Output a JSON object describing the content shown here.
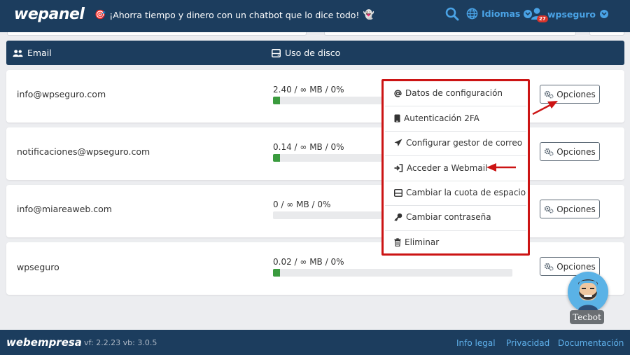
{
  "colors": {
    "navy": "#1c3d5e",
    "accent_blue": "#4aa3e6",
    "progress_green": "#3a9b3e",
    "annotation_red": "#cc1414"
  },
  "topbar": {
    "logo": "wepanel",
    "promo_icon": "target-emoji",
    "promo_text": "¡Ahorra tiempo y dinero con un chatbot que lo dice todo!",
    "promo_icon_end": "ghost-emoji",
    "search_icon": "search-icon",
    "languages_label": "Idiomas",
    "user_label": "wpseguro",
    "notification_count": "27"
  },
  "table": {
    "col_email": "Email",
    "col_disk": "Uso de disco",
    "rows": [
      {
        "email": "info@wpseguro.com",
        "usage": "2.40 / ∞ MB / 0%",
        "fill_percent": 3,
        "options_label": "Opciones"
      },
      {
        "email": "notificaciones@wpseguro.com",
        "usage": "0.14 / ∞ MB / 0%",
        "fill_percent": 3,
        "options_label": "Opciones"
      },
      {
        "email": "info@miareaweb.com",
        "usage": "0 / ∞ MB / 0%",
        "fill_percent": 0,
        "options_label": "Opciones"
      },
      {
        "email": "wpseguro",
        "usage": "0.02 / ∞ MB / 0%",
        "fill_percent": 3,
        "options_label": "Opciones"
      }
    ]
  },
  "dropdown": {
    "items": [
      {
        "label": "Datos de configuración",
        "icon": "at-icon"
      },
      {
        "label": "Autenticación 2FA",
        "icon": "phone-icon"
      },
      {
        "label": "Configurar gestor de correo",
        "icon": "paper-plane-icon"
      },
      {
        "label": "Acceder a Webmail",
        "icon": "sign-in-icon"
      },
      {
        "label": "Cambiar la cuota de espacio",
        "icon": "drive-icon"
      },
      {
        "label": "Cambiar contraseña",
        "icon": "key-icon"
      },
      {
        "label": "Eliminar",
        "icon": "trash-icon"
      }
    ]
  },
  "tecbot": {
    "label": "Tecbot"
  },
  "footer": {
    "logo": "webempresa",
    "version": "vf: 2.2.23 vb: 3.0.5",
    "links": [
      "Info legal",
      "Privacidad",
      "Documentación"
    ]
  }
}
